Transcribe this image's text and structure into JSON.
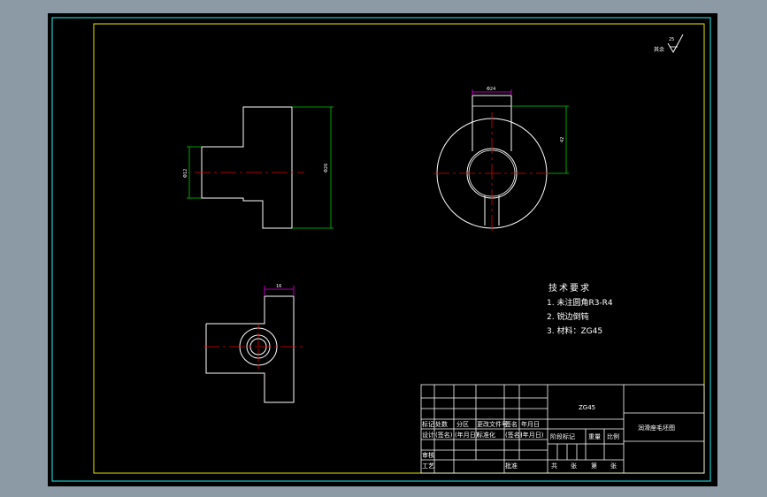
{
  "surface_finish": {
    "label": "其余",
    "value": "25"
  },
  "front_view": {
    "dim_left": "Φ12",
    "dim_right": "Φ26"
  },
  "top_view": {
    "dim_top": "Φ24",
    "dim_right": "42"
  },
  "side_view": {
    "dim_top": "16"
  },
  "tech_requirements": {
    "title": "技术要求",
    "items": [
      "1. 未注圆角R3-R4",
      "2. 锐边倒钝",
      "3. 材料：ZG45"
    ]
  },
  "title_block": {
    "material": "ZG45",
    "drawing_name": "润滑座毛坯图",
    "row_labels": [
      "标记",
      "设计",
      "审核",
      "工艺"
    ],
    "revision_headers": [
      "处数",
      "分区",
      "更改文件号",
      "签名",
      "年月日"
    ],
    "design_row": [
      "(签名)",
      "(年月日)",
      "标准化",
      "(签名)",
      "(年月日)"
    ],
    "approve_label": "批准",
    "stage_headers": [
      "阶段标记",
      "重量",
      "比例"
    ],
    "sheet_labels": [
      "共",
      "张",
      "第",
      "张"
    ]
  }
}
